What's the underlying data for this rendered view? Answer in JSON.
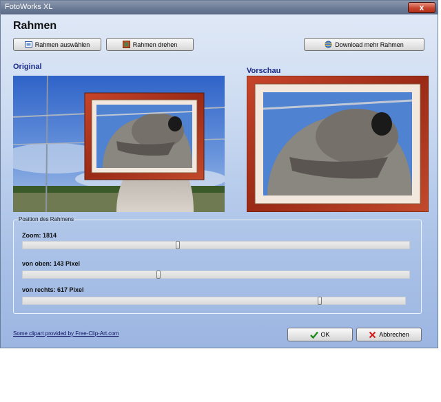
{
  "window": {
    "title": "FotoWorks XL",
    "close_glyph": "x"
  },
  "page": {
    "heading": "Rahmen"
  },
  "toolbar": {
    "select_frame_label": "Rahmen auswählen",
    "rotate_frame_label": "Rahmen drehen",
    "download_label": "Download mehr Rahmen",
    "icons": {
      "select": "frame-icon",
      "rotate": "rotate-frame-icon",
      "download": "ie-globe-icon"
    }
  },
  "original": {
    "label": "Original"
  },
  "preview": {
    "label": "Vorschau"
  },
  "position": {
    "group_title": "Position des Rahmens",
    "zoom": {
      "label": "Zoom: 1814",
      "value": 1814,
      "level": 0.4
    },
    "top": {
      "label": "von oben: 143 Pixel",
      "value": 143,
      "level": 0.35
    },
    "right": {
      "label": "von rechts: 617 Pixel",
      "value": 617,
      "level": 0.78
    }
  },
  "footer": {
    "credit_link": "Some clipart provided by Free-Clip-Art.com",
    "ok_label": "OK",
    "cancel_label": "Abbrechen"
  },
  "colors": {
    "heading_blue": "#1a2a8a",
    "frame_red": "#b2321a",
    "ok_green": "#1e8a1e",
    "cancel_red": "#d42020"
  }
}
